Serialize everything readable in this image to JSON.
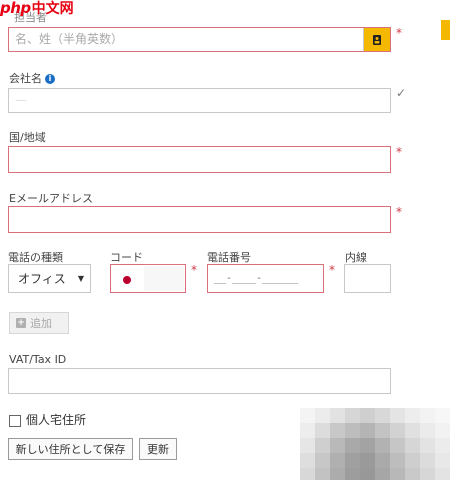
{
  "watermark": {
    "php": "php",
    "site": "中文网"
  },
  "form": {
    "contact_name": {
      "label": "担当者",
      "placeholder": "名、姓（半角英数）",
      "required_mark": "*"
    },
    "company_name": {
      "label": "会社名",
      "info_icon_glyph": "i",
      "placeholder": "—",
      "valid_mark": "✓"
    },
    "country": {
      "label": "国/地域",
      "required_mark": "*"
    },
    "email": {
      "label": "Eメールアドレス",
      "required_mark": "*"
    },
    "phone": {
      "type_label": "電話の種類",
      "type_value": "オフィス",
      "type_caret": "▼",
      "code_label": "コード",
      "code_required_mark": "*",
      "number_label": "電話番号",
      "number_mask": "__-____-______",
      "number_required_mark": "*",
      "ext_label": "内線"
    },
    "add_button": {
      "icon": "+",
      "label": "追加"
    },
    "vat": {
      "label": "VAT/Tax ID"
    },
    "personal_address": {
      "label": "個人宅住所"
    },
    "buttons": {
      "save_new": "新しい住所として保存",
      "update": "更新"
    }
  },
  "colors": {
    "accent": "#f5b800",
    "error_border": "#d9707a",
    "required": "#d03a48",
    "info": "#1a6fc4",
    "flag_red": "#bc002d"
  }
}
